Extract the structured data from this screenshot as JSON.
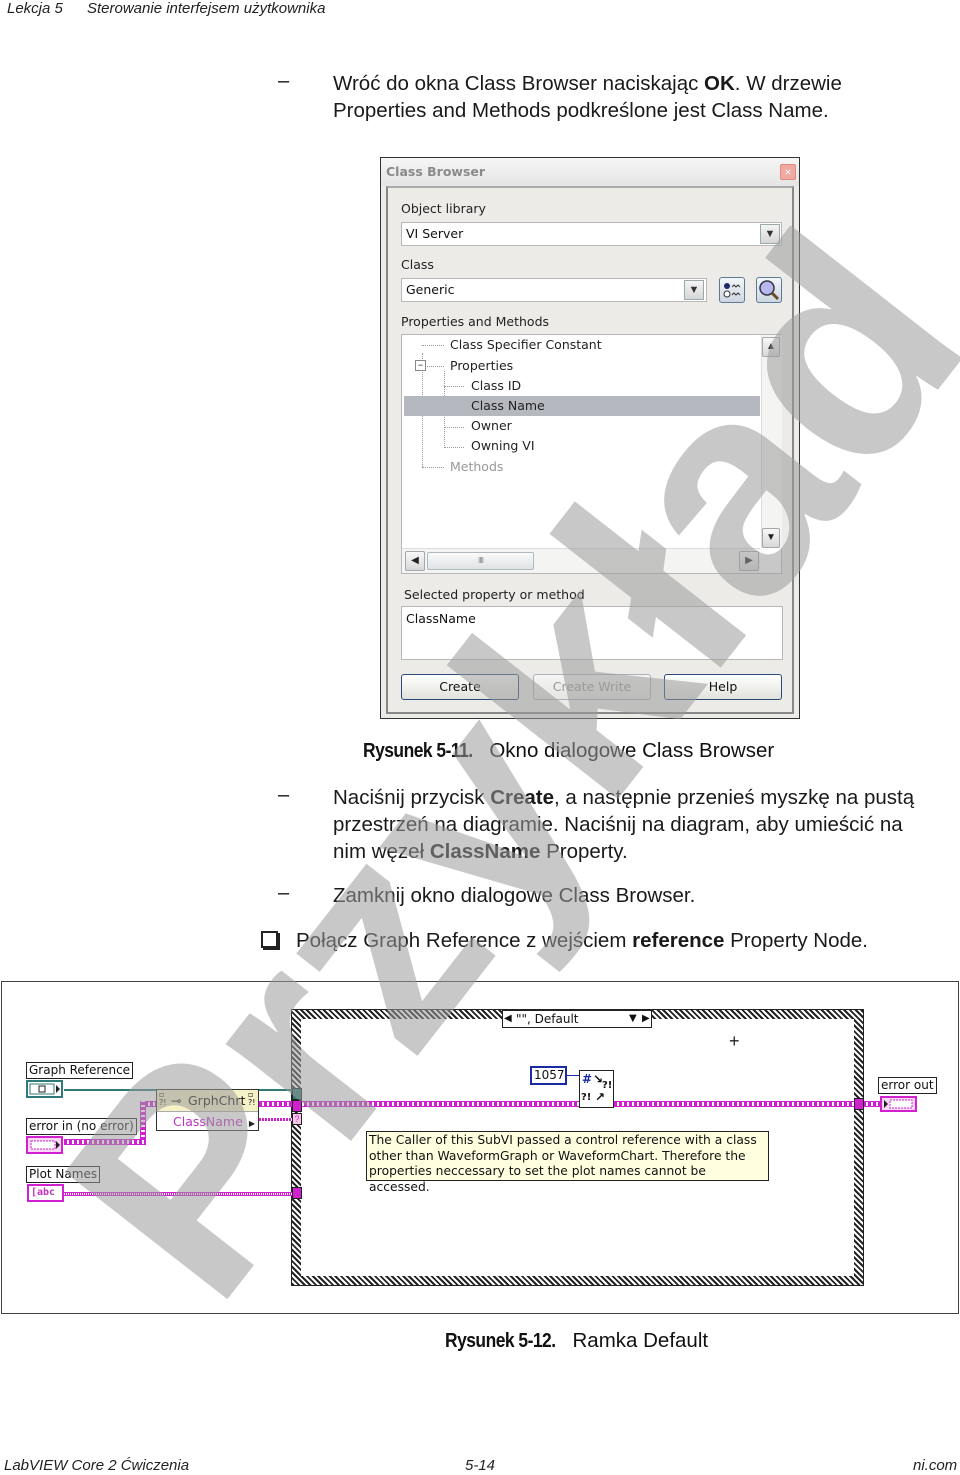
{
  "header": {
    "lesson": "Lekcja 5",
    "title": "Sterowanie interfejsem użytkownika"
  },
  "step1": {
    "line1_pre": "Wróć do okna Class Browser naciskając ",
    "line1_bold": "OK",
    "line1_post": ". W drzewie",
    "line2": "Properties and Methods podkreślone jest Class Name."
  },
  "class_browser": {
    "title": "Class Browser",
    "close_glyph": "×",
    "object_library_label": "Object library",
    "object_library_value": "VI Server",
    "class_label": "Class",
    "class_value": "Generic",
    "props_label": "Properties and Methods",
    "tree": [
      {
        "label": "Class Specifier Constant",
        "level": 0,
        "selected": false,
        "disabled": false
      },
      {
        "label": "Properties",
        "level": 0,
        "selected": false,
        "disabled": false,
        "expanded": true
      },
      {
        "label": "Class ID",
        "level": 1,
        "selected": false,
        "disabled": false
      },
      {
        "label": "Class Name",
        "level": 1,
        "selected": true,
        "disabled": false
      },
      {
        "label": "Owner",
        "level": 1,
        "selected": false,
        "disabled": false
      },
      {
        "label": "Owning VI",
        "level": 1,
        "selected": false,
        "disabled": false
      },
      {
        "label": "Methods",
        "level": 0,
        "selected": false,
        "disabled": true
      }
    ],
    "selected_label": "Selected property or method",
    "selected_value": "ClassName",
    "buttons": {
      "create": "Create",
      "create_write": "Create Write",
      "help": "Help"
    },
    "icons": {
      "collapse": "⊟",
      "scroll_up": "▲",
      "scroll_down": "▼",
      "scroll_left": "◀",
      "scroll_right": "▶",
      "combo_arrow": "▼",
      "thumb_grip": "IIII"
    }
  },
  "figure1": {
    "number": "Rysunek 5-11.",
    "caption": "Okno dialogowe Class Browser"
  },
  "step2": {
    "p1_pre": "Naciśnij przycisk ",
    "p1_bold": "Create",
    "p1_post": ", a następnie przenieś myszkę na pustą",
    "p2": "przestrzeń na diagramie. Naciśnij na diagram, aby umieścić na",
    "p3_pre": "nim węzeł ",
    "p3_bold": "ClassName",
    "p3_post": " Property."
  },
  "step3": {
    "text": "Zamknij okno dialogowe Class Browser."
  },
  "task": {
    "pre": "Połącz Graph Reference z wejściem ",
    "bold": "reference",
    "post": " Property Node."
  },
  "dash": "–",
  "block_diagram": {
    "case_selector": "\"\", Default",
    "labels": {
      "graph_reference": "Graph Reference",
      "error_in": "error in (no error)",
      "plot_names": "Plot Names",
      "error_out": "error out"
    },
    "plot_names_terminal": "[abc",
    "property_node": {
      "class": "GrphChrt",
      "property": "ClassName"
    },
    "numeric_constant": "1057",
    "comment": "The Caller of this SubVI passed a control reference with a class other than WaveformGraph or WaveformChart.  Therefore the properties neccessary to set the plot names cannot be accessed.",
    "colors": {
      "reference_wire": "#2e7a78",
      "error_wire": "#d020d0",
      "comment_bg": "#ffffe0",
      "node_header": "#f6f2c8"
    }
  },
  "figure2": {
    "number": "Rysunek 5-12.",
    "caption": "Ramka Default"
  },
  "footer": {
    "left": "LabVIEW Core 2 Ćwiczenia",
    "center": "5-14",
    "right": "ni.com"
  },
  "watermark": {
    "text": "Przykład",
    "color": "#9a9a9a"
  }
}
